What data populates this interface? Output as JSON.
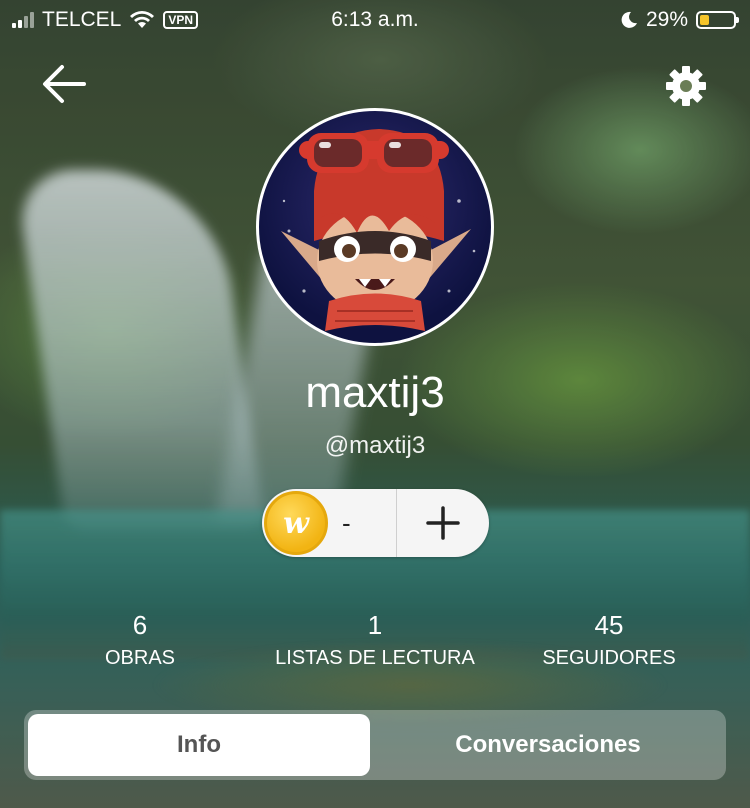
{
  "status_bar": {
    "carrier": "TELCEL",
    "vpn": "VPN",
    "time": "6:13 a.m.",
    "battery": "29%",
    "battery_level": 0.29
  },
  "header": {
    "back_icon": "back-arrow-icon",
    "settings_icon": "gear-icon"
  },
  "profile": {
    "display_name": "maxtij3",
    "username": "@maxtij3",
    "avatar_icon": "avatar-image"
  },
  "coins": {
    "icon": "wattpad-coin-icon",
    "coin_letter": "w",
    "balance": "-",
    "add_icon": "plus-icon"
  },
  "stats": [
    {
      "value": "6",
      "label": "OBRAS"
    },
    {
      "value": "1",
      "label": "LISTAS DE LECTURA"
    },
    {
      "value": "45",
      "label": "SEGUIDORES"
    }
  ],
  "tabs": {
    "info": "Info",
    "conversations": "Conversaciones",
    "active": "info"
  },
  "colors": {
    "coin": "#f2b413",
    "tab_active_bg": "#ffffff",
    "battery_fill": "#f5c52a"
  }
}
